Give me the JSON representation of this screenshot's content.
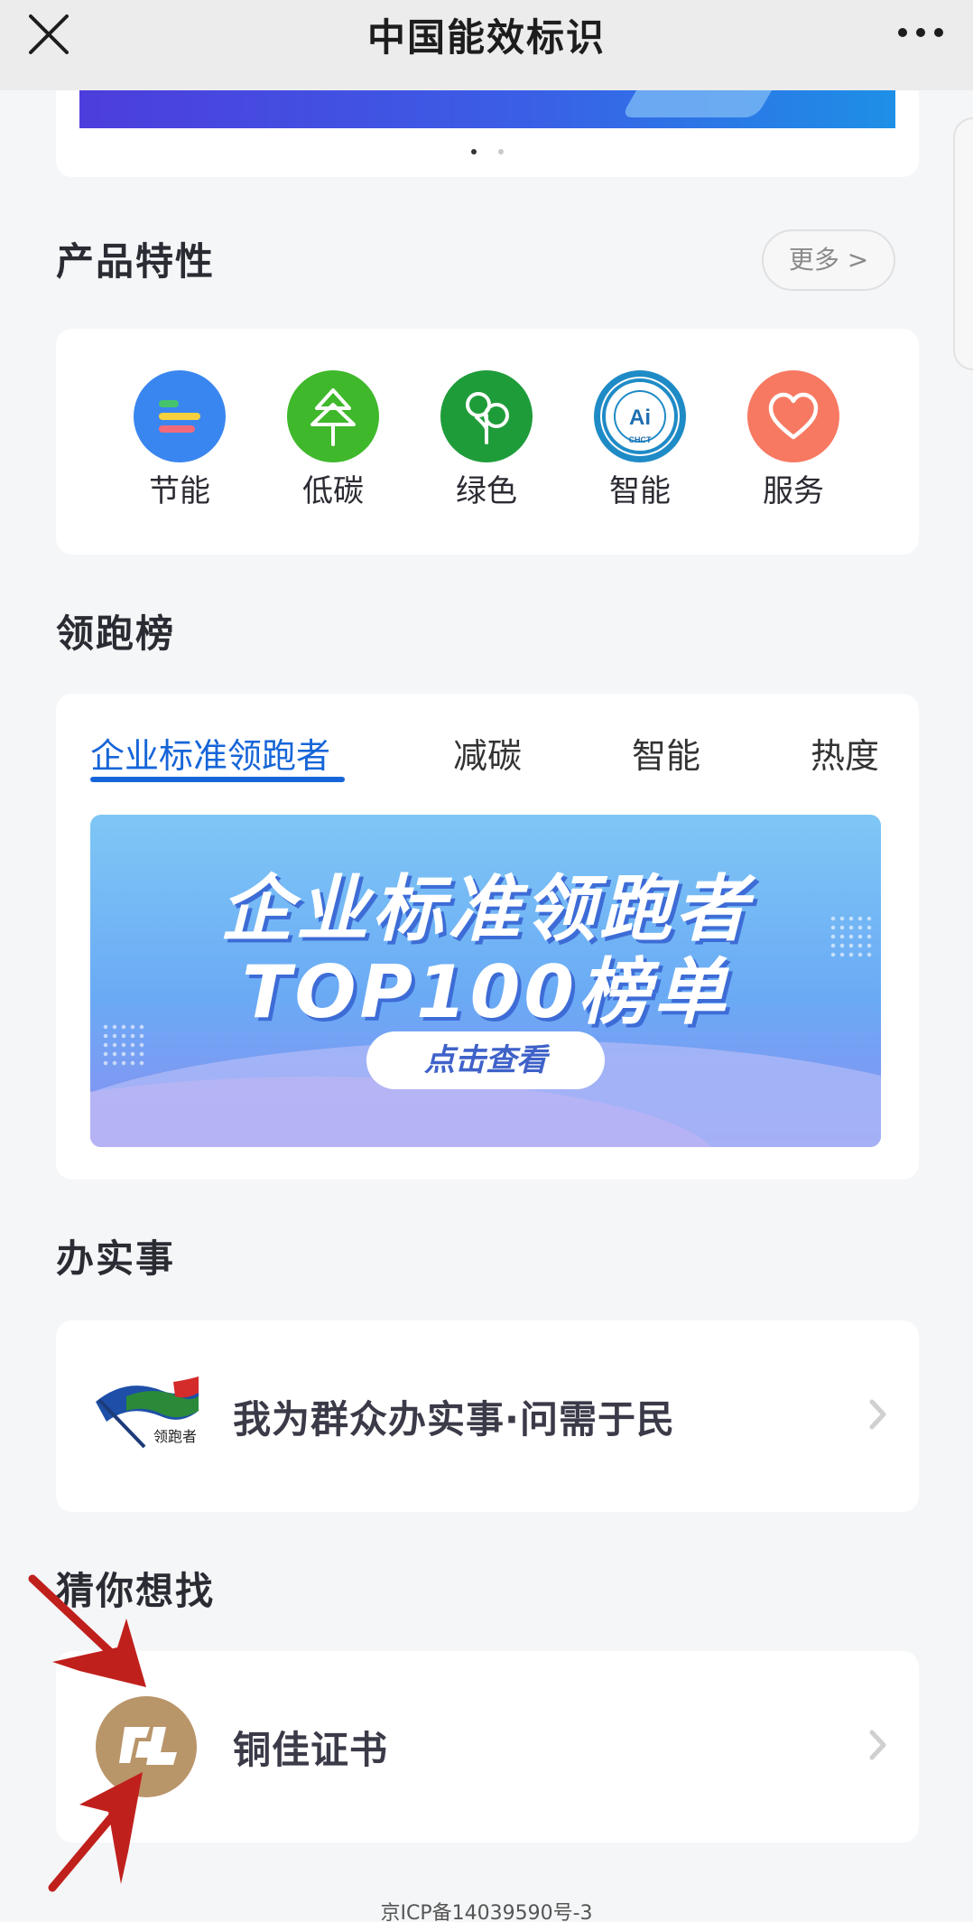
{
  "navbar": {
    "title": "中国能效标识",
    "close_icon": "close-icon",
    "more_icon": "more-dots-icon"
  },
  "banner": {
    "dots": 2,
    "active_dot": 0
  },
  "features": {
    "title": "产品特性",
    "more_label": "更多 >",
    "items": [
      {
        "label": "节能",
        "icon": "energy-saving-icon",
        "color": "#3a86f0"
      },
      {
        "label": "低碳",
        "icon": "tree-icon",
        "color": "#3fb82b"
      },
      {
        "label": "绿色",
        "icon": "green-leaf-icon",
        "color": "#1f9c3a"
      },
      {
        "label": "智能",
        "icon": "ai-certification-icon",
        "color": "#1f8bc6"
      },
      {
        "label": "服务",
        "icon": "heart-icon",
        "color": "#f77962"
      }
    ]
  },
  "leaderboard": {
    "title": "领跑榜",
    "tabs": [
      {
        "label": "企业标准领跑者",
        "active": true
      },
      {
        "label": "减碳",
        "active": false
      },
      {
        "label": "智能",
        "active": false
      },
      {
        "label": "热度",
        "active": false
      }
    ],
    "promo": {
      "line1": "企业标准领跑者",
      "line2": "TOP100榜单",
      "button": "点击查看"
    }
  },
  "services": {
    "title": "办实事",
    "item": {
      "label": "我为群众办实事·问需于民",
      "logo_text": "领跑者",
      "icon": "flag-logo-icon"
    }
  },
  "guess": {
    "title": "猜你想找",
    "item": {
      "label": "铜佳证书",
      "icon": "tongjia-logo-icon"
    }
  },
  "footer": {
    "icp": "京ICP备14039590号-3"
  },
  "colors": {
    "accent": "#1665d8",
    "annotation_arrow": "#c0201c"
  }
}
